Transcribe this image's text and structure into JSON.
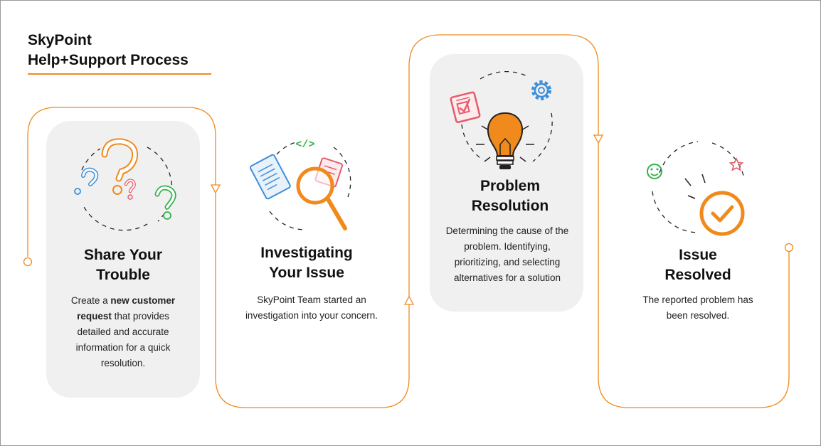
{
  "header": {
    "title_line1": "SkyPoint",
    "title_line2": "Help+Support Process"
  },
  "colors": {
    "accent": "#f08a1c",
    "card": "#f0f0f0",
    "blue": "#3d8fd9",
    "green": "#2fb34a",
    "pink": "#e85a6a"
  },
  "steps": [
    {
      "icon": "question-marks-icon",
      "title_line1": "Share Your",
      "title_line2": "Trouble",
      "desc_parts": [
        "Create a ",
        "new customer request",
        " that provides detailed and accurate information for a quick resolution."
      ]
    },
    {
      "icon": "magnifier-documents-icon",
      "code_glyph": "</>",
      "title_line1": "Investigating",
      "title_line2": "Your Issue",
      "desc": "SkyPoint Team started an investigation into your concern."
    },
    {
      "icon": "lightbulb-gear-icon",
      "title_line1": "Problem",
      "title_line2": "Resolution",
      "desc": "Determining the cause of the problem. Identifying, prioritizing, and selecting alternatives for a solution"
    },
    {
      "icon": "checkmark-circle-icon",
      "title_line1": "Issue",
      "title_line2": "Resolved",
      "desc": "The reported problem has been resolved."
    }
  ]
}
